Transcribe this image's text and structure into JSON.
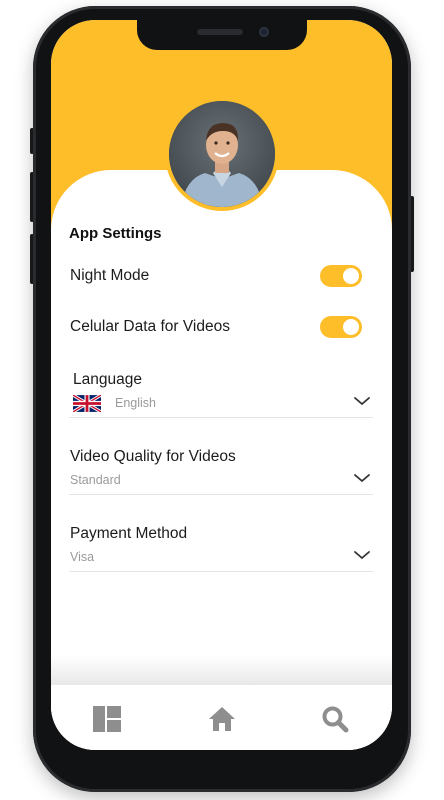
{
  "settings": {
    "title": "App Settings",
    "toggles": [
      {
        "label": "Night Mode",
        "on": true
      },
      {
        "label": "Celular Data for Videos",
        "on": true
      }
    ],
    "language": {
      "label": "Language",
      "value": "English",
      "flag": "uk-flag-icon"
    },
    "video_quality": {
      "label": "Video Quality for Videos",
      "value": "Standard"
    },
    "payment": {
      "label": "Payment Method",
      "value": "Visa"
    }
  },
  "tabs": [
    {
      "icon": "dashboard-grid-icon"
    },
    {
      "icon": "home-icon"
    },
    {
      "icon": "search-icon"
    }
  ],
  "colors": {
    "accent": "#FDBE2A",
    "icon_gray": "#8e8e8e",
    "text": "#1c1c1c",
    "muted": "#9a9a9a"
  }
}
